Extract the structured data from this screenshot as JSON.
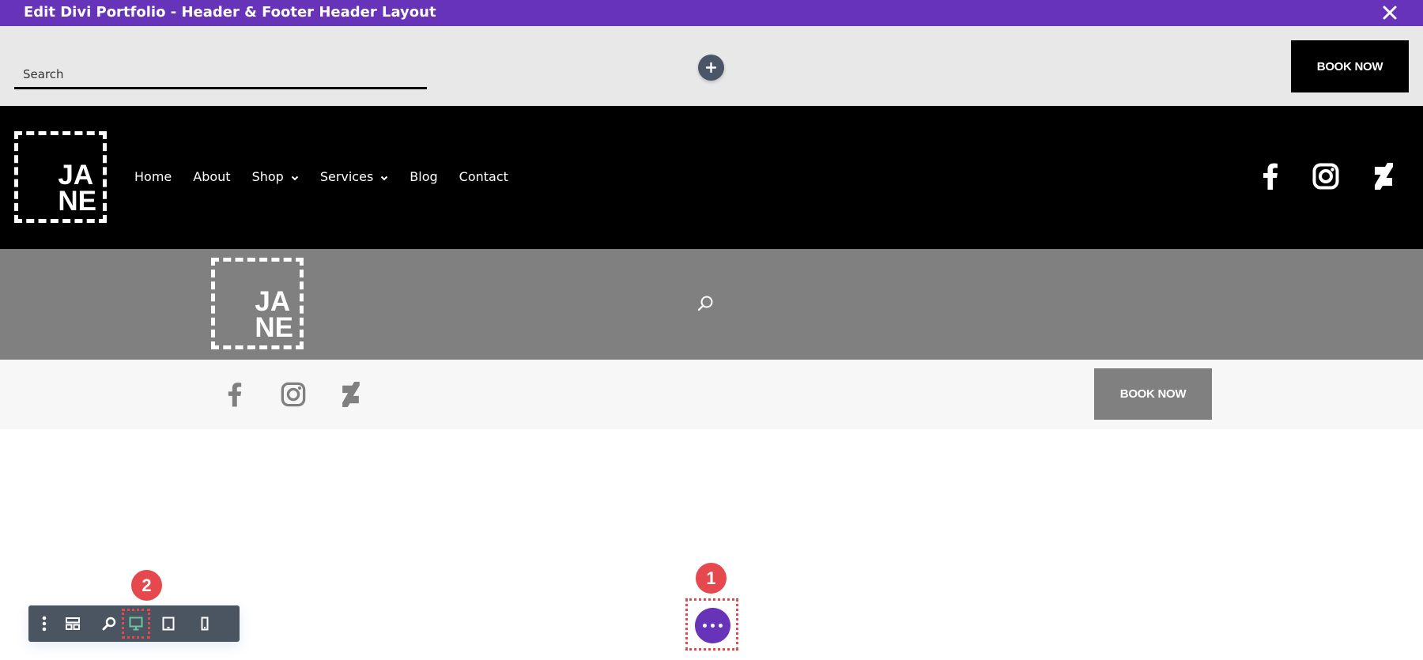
{
  "window": {
    "title": "Edit Divi Portfolio - Header & Footer Header Layout",
    "close_icon": "close-icon"
  },
  "top_row": {
    "search": {
      "placeholder": "Search",
      "value": ""
    },
    "add_icon": "plus-icon",
    "book_button": "BOOK NOW"
  },
  "nav_section": {
    "logo": {
      "line1": "JA",
      "line2": "NE"
    },
    "menu": [
      {
        "label": "Home",
        "has_submenu": false
      },
      {
        "label": "About",
        "has_submenu": false
      },
      {
        "label": "Shop",
        "has_submenu": true
      },
      {
        "label": "Services",
        "has_submenu": true
      },
      {
        "label": "Blog",
        "has_submenu": false
      },
      {
        "label": "Contact",
        "has_submenu": false
      }
    ],
    "social": [
      "facebook-icon",
      "instagram-icon",
      "deviantart-icon"
    ]
  },
  "gray_section": {
    "logo": {
      "line1": "JA",
      "line2": "NE"
    },
    "search_icon": "search-icon"
  },
  "light_section": {
    "social": [
      "facebook-icon",
      "instagram-icon",
      "deviantart-icon"
    ],
    "book_button": "BOOK NOW"
  },
  "builder_toolbar": {
    "items": [
      {
        "name": "settings-menu",
        "icon": "vertical-dots-icon",
        "active": false
      },
      {
        "name": "wireframe-view",
        "icon": "layout-icon",
        "active": false
      },
      {
        "name": "zoom-view",
        "icon": "zoom-icon",
        "active": false
      },
      {
        "name": "desktop-view",
        "icon": "desktop-icon",
        "active": true
      },
      {
        "name": "tablet-view",
        "icon": "tablet-icon",
        "active": false
      },
      {
        "name": "phone-view",
        "icon": "phone-icon",
        "active": false
      }
    ]
  },
  "annotations": {
    "badge_1": "1",
    "badge_2": "2"
  },
  "colors": {
    "divi_purple": "#6733b9",
    "toolbar_bg": "#4a5561",
    "active_view": "#6cc4a1",
    "annotation_red": "#e5484d",
    "nav_bg": "#000000",
    "gray_bg": "#808080"
  }
}
